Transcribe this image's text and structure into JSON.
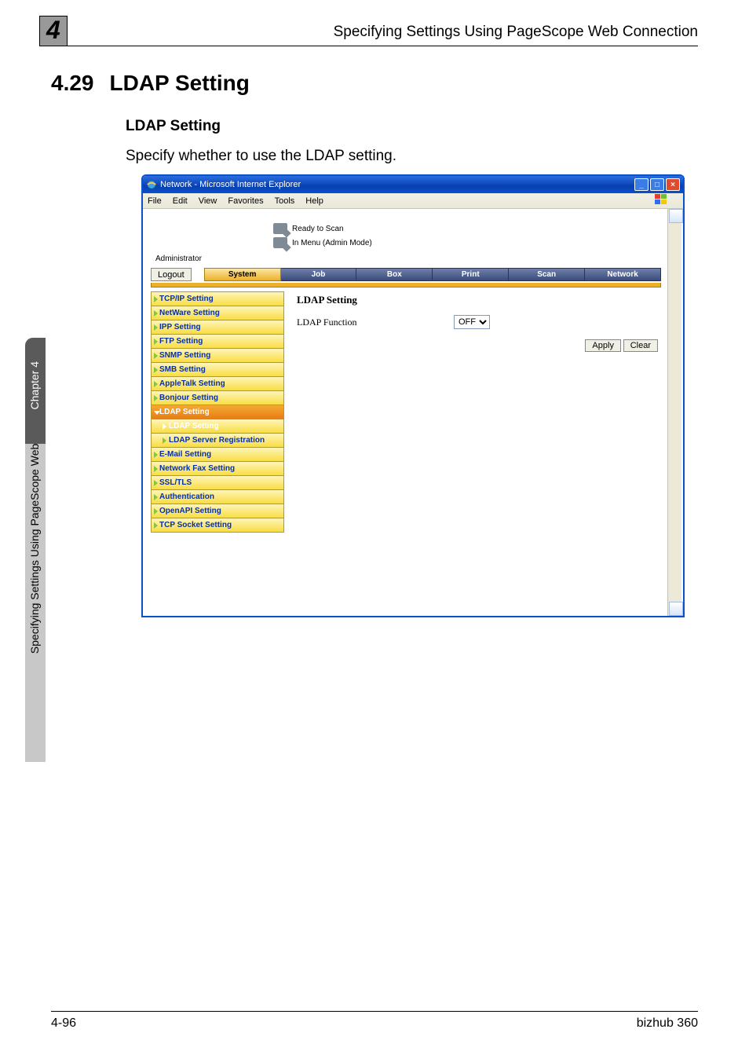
{
  "page_marker": "4",
  "header_title": "Specifying Settings Using PageScope Web Connection",
  "section": {
    "number": "4.29",
    "title": "LDAP Setting"
  },
  "subheading": "LDAP Setting",
  "body": "Specify whether to use the LDAP setting.",
  "side_tab": {
    "dark": "Chapter 4",
    "light": "Specifying Settings Using PageScope Web Connection"
  },
  "footer": {
    "left": "4-96",
    "right": "bizhub 360"
  },
  "ie": {
    "title": "Network - Microsoft Internet Explorer",
    "menus": [
      "File",
      "Edit",
      "View",
      "Favorites",
      "Tools",
      "Help"
    ],
    "status1": "Ready to Scan",
    "status2": "In Menu (Admin Mode)",
    "admin": "Administrator",
    "logout": "Logout",
    "tabs": [
      "System",
      "Job",
      "Box",
      "Print",
      "Scan",
      "Network"
    ],
    "sidebar": [
      {
        "label": "TCP/IP Setting",
        "type": "item"
      },
      {
        "label": "NetWare Setting",
        "type": "item"
      },
      {
        "label": "IPP Setting",
        "type": "item"
      },
      {
        "label": "FTP Setting",
        "type": "item"
      },
      {
        "label": "SNMP Setting",
        "type": "item"
      },
      {
        "label": "SMB Setting",
        "type": "item"
      },
      {
        "label": "AppleTalk Setting",
        "type": "item"
      },
      {
        "label": "Bonjour Setting",
        "type": "item"
      },
      {
        "label": "LDAP Setting",
        "type": "selected"
      },
      {
        "label": "LDAP Setting",
        "type": "sub-selected"
      },
      {
        "label": "LDAP Server Registration",
        "type": "sub"
      },
      {
        "label": "E-Mail Setting",
        "type": "item"
      },
      {
        "label": "Network Fax Setting",
        "type": "item"
      },
      {
        "label": "SSL/TLS",
        "type": "item"
      },
      {
        "label": "Authentication",
        "type": "item"
      },
      {
        "label": "OpenAPI Setting",
        "type": "item"
      },
      {
        "label": "TCP Socket Setting",
        "type": "item"
      }
    ],
    "detail": {
      "heading": "LDAP Setting",
      "field_label": "LDAP Function",
      "field_value": "OFF",
      "apply": "Apply",
      "clear": "Clear"
    }
  }
}
